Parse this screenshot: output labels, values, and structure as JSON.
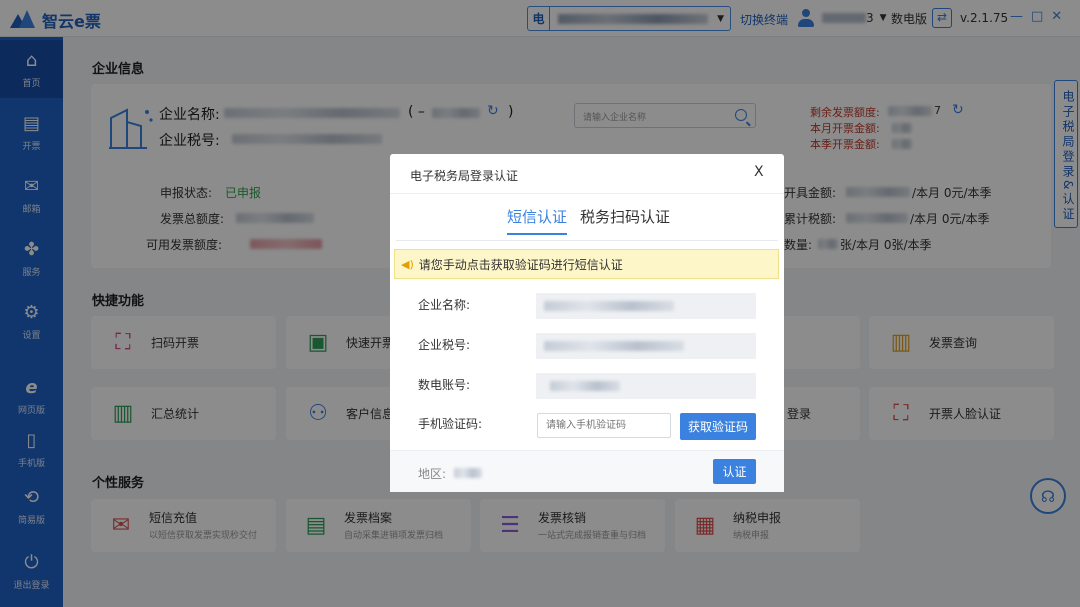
{
  "app": {
    "name": "智云e票"
  },
  "titlebar": {
    "terminal_prefix": "电",
    "switch_label": "切换终端",
    "user_suffix": "3",
    "mode_label": "数电版",
    "version": "v.2.1.75",
    "win_min": "—",
    "win_max": "□",
    "win_close": "✕"
  },
  "sidebar": {
    "items": [
      {
        "label": "首页",
        "icon": "home-icon"
      },
      {
        "label": "开票",
        "icon": "invoice-icon"
      },
      {
        "label": "邮箱",
        "icon": "mail-icon"
      },
      {
        "label": "服务",
        "icon": "service-icon"
      },
      {
        "label": "设置",
        "icon": "gear-icon"
      },
      {
        "label": "网页版",
        "icon": "browser-icon"
      },
      {
        "label": "手机版",
        "icon": "mobile-icon"
      },
      {
        "label": "简易版",
        "icon": "simple-icon"
      },
      {
        "label": "退出登录",
        "icon": "power-icon"
      }
    ]
  },
  "company": {
    "section_title": "企业信息",
    "name_label": "企业名称:",
    "tax_label": "企业税号:",
    "paren_open": "( –",
    "paren_close": ")",
    "search_placeholder": "请输入企业名称",
    "status_label": "申报状态:",
    "status_value": "已申报",
    "total_quota_label": "发票总额度:",
    "available_quota_label": "可用发票额度:",
    "remaining_label": "剩余发票额度:",
    "remaining_tail": "7",
    "month_amount_label": "本月开票金额:",
    "quarter_amount_label": "本季开票金额:",
    "right1_label": "开具金额:",
    "right1_tail": "/本月 0元/本季",
    "right2_label": "累计税额:",
    "right2_tail": "/本月 0元/本季",
    "right3_label": "数量:",
    "right3_tail": "张/本月 0张/本季",
    "side_tab": "电子税局登录&认证"
  },
  "quick": {
    "section_title": "快捷功能",
    "tiles": [
      {
        "label": "扫码开票"
      },
      {
        "label": "快速开票"
      },
      {
        "label": "发票查询"
      },
      {
        "label": "汇总统计"
      },
      {
        "label": "客户信息"
      },
      {
        "label": "登录"
      },
      {
        "label": "开票人脸认证"
      }
    ]
  },
  "personal": {
    "section_title": "个性服务",
    "tiles": [
      {
        "label": "短信充值",
        "sub": "以短信获取发票实现秒交付"
      },
      {
        "label": "发票档案",
        "sub": "自动采集进销项发票归档"
      },
      {
        "label": "发票核销",
        "sub": "一站式完成报销查重与归档"
      },
      {
        "label": "纳税申报",
        "sub": "纳税申报"
      }
    ]
  },
  "modal": {
    "title": "电子税务局登录认证",
    "close": "X",
    "tab_sms": "短信认证",
    "tab_scan": "税务扫码认证",
    "notice": "请您手动点击获取验证码进行短信认证",
    "name_label": "企业名称:",
    "tax_label": "企业税号:",
    "account_label": "数电账号:",
    "code_label": "手机验证码:",
    "code_placeholder": "请输入手机验证码",
    "get_code_button": "获取验证码",
    "region_label": "地区:",
    "confirm_button": "认证"
  }
}
